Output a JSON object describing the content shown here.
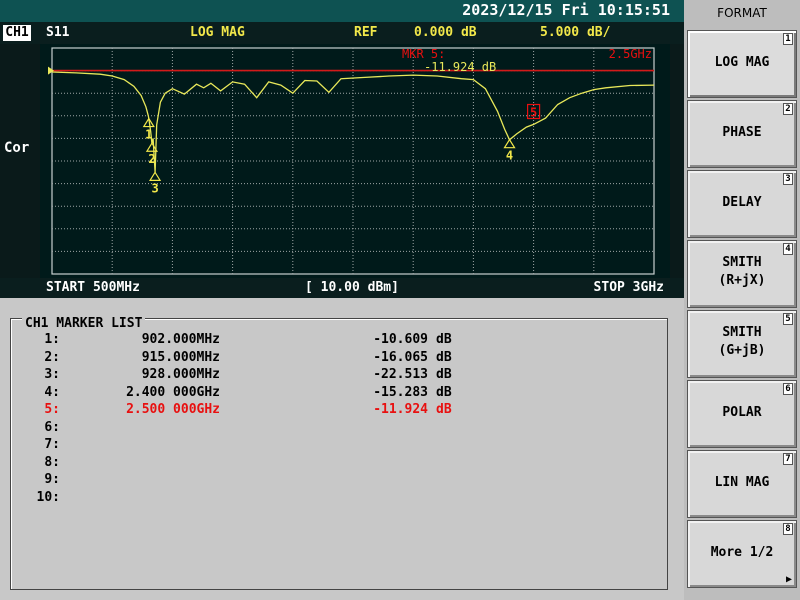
{
  "topbar": {
    "datetime": "2023/12/15 Fri 10:15:51"
  },
  "header": {
    "channel": "CH1",
    "parameter": "S11",
    "format": "LOG MAG",
    "ref_label": "REF",
    "ref_value": "0.000 dB",
    "scale": "5.000 dB/"
  },
  "side": {
    "cor": "Cor"
  },
  "plot": {
    "active_marker_label": "MKR 5:",
    "active_marker_freq": "2.5GHz",
    "active_marker_value": "-11.924 dB",
    "start": "START 500MHz",
    "power": "[ 10.00 dBm]",
    "stop": "STOP 3GHz",
    "colors": {
      "trace": "#e8e85a",
      "grid": "#9ea6a6",
      "ref_line": "#d21a1a",
      "marker_active": "#e81010",
      "marker": "#f2e84a"
    }
  },
  "chart_data": {
    "type": "line",
    "x_unit": "GHz",
    "y_unit": "dB",
    "xlim": [
      0.5,
      3.0
    ],
    "ylim": [
      -45,
      5
    ],
    "grid": true,
    "ref_level": 0,
    "series": [
      {
        "x": [
          0.5,
          0.6,
          0.7,
          0.75,
          0.8,
          0.84,
          0.87,
          0.89,
          0.9,
          0.902,
          0.91,
          0.915,
          0.92,
          0.928,
          0.935,
          0.95,
          0.97,
          1.0,
          1.05,
          1.1,
          1.13,
          1.16,
          1.2,
          1.25,
          1.3,
          1.35,
          1.4,
          1.45,
          1.5,
          1.55,
          1.6,
          1.65,
          1.7,
          1.8,
          1.9,
          2.0,
          2.1,
          2.2,
          2.25,
          2.3,
          2.35,
          2.38,
          2.4,
          2.43,
          2.47,
          2.5,
          2.55,
          2.6,
          2.65,
          2.7,
          2.75,
          2.8,
          2.9,
          3.0
        ],
        "y": [
          -0.3,
          -0.5,
          -0.8,
          -1.2,
          -2.0,
          -3.5,
          -5.5,
          -8.0,
          -10.0,
          -10.6,
          -13.5,
          -16.1,
          -15.0,
          -22.5,
          -12.0,
          -7.0,
          -5.0,
          -4.0,
          -5.2,
          -3.0,
          -3.8,
          -2.8,
          -4.5,
          -2.5,
          -3.0,
          -6.0,
          -2.5,
          -3.2,
          -5.0,
          -2.2,
          -2.3,
          -4.8,
          -1.8,
          -1.5,
          -1.2,
          -1.0,
          -1.2,
          -1.8,
          -2.0,
          -4.0,
          -9.0,
          -13.0,
          -15.3,
          -14.0,
          -12.5,
          -11.9,
          -10.5,
          -7.5,
          -6.0,
          -5.0,
          -4.2,
          -3.8,
          -3.3,
          -3.2
        ]
      }
    ],
    "markers": [
      {
        "id": "1",
        "x": 0.902,
        "y": -10.609
      },
      {
        "id": "2",
        "x": 0.915,
        "y": -16.065
      },
      {
        "id": "3",
        "x": 0.928,
        "y": -22.513
      },
      {
        "id": "4",
        "x": 2.4,
        "y": -15.283
      },
      {
        "id": "5",
        "x": 2.5,
        "y": -11.924,
        "active": true
      }
    ]
  },
  "marker_list": {
    "title": "CH1 MARKER LIST",
    "rows": [
      {
        "idx": "1:",
        "freq": "902.000MHz",
        "val": "-10.609",
        "unit": "dB",
        "active": false
      },
      {
        "idx": "2:",
        "freq": "915.000MHz",
        "val": "-16.065",
        "unit": "dB",
        "active": false
      },
      {
        "idx": "3:",
        "freq": "928.000MHz",
        "val": "-22.513",
        "unit": "dB",
        "active": false
      },
      {
        "idx": "4:",
        "freq": "2.400 000GHz",
        "val": "-15.283",
        "unit": "dB",
        "active": false
      },
      {
        "idx": "5:",
        "freq": "2.500 000GHz",
        "val": "-11.924",
        "unit": "dB",
        "active": true
      },
      {
        "idx": "6:",
        "freq": "",
        "val": "",
        "unit": "",
        "active": false
      },
      {
        "idx": "7:",
        "freq": "",
        "val": "",
        "unit": "",
        "active": false
      },
      {
        "idx": "8:",
        "freq": "",
        "val": "",
        "unit": "",
        "active": false
      },
      {
        "idx": "9:",
        "freq": "",
        "val": "",
        "unit": "",
        "active": false
      },
      {
        "idx": "10:",
        "freq": "",
        "val": "",
        "unit": "",
        "active": false
      }
    ]
  },
  "softkeys": {
    "title": "FORMAT",
    "items": [
      {
        "line1": "LOG MAG",
        "line2": "",
        "num": "1",
        "selected": true
      },
      {
        "line1": "PHASE",
        "line2": "",
        "num": "2"
      },
      {
        "line1": "DELAY",
        "line2": "",
        "num": "3"
      },
      {
        "line1": "SMITH",
        "line2": "(R+jX)",
        "num": "4"
      },
      {
        "line1": "SMITH",
        "line2": "(G+jB)",
        "num": "5"
      },
      {
        "line1": "POLAR",
        "line2": "",
        "num": "6"
      },
      {
        "line1": "LIN MAG",
        "line2": "",
        "num": "7"
      },
      {
        "line1": "More 1/2",
        "line2": "",
        "num": "8",
        "arrow": "▶"
      }
    ]
  }
}
